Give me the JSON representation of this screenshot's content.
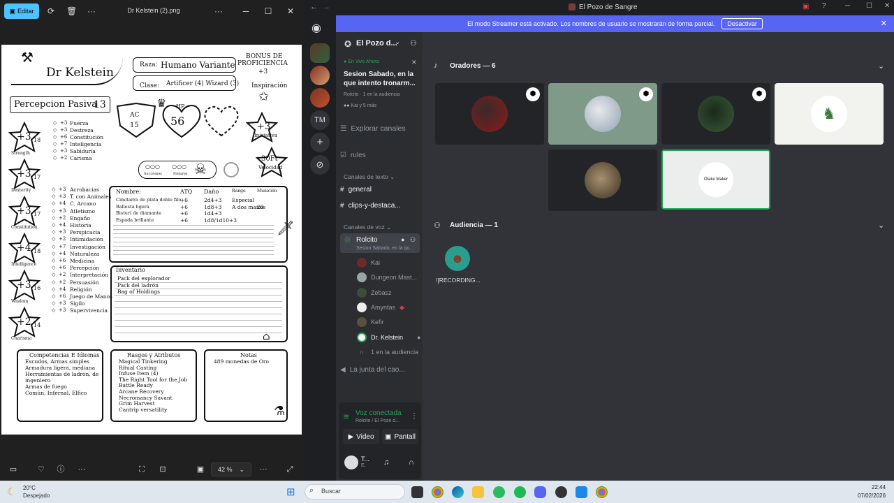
{
  "viewer": {
    "edit_label": "Editar",
    "title": "Dr Kelstein (2).png",
    "zoom": "42 %",
    "sheet": {
      "name": "Dr Kelstein",
      "race_label": "Raza:",
      "race_value": "Humano Variante",
      "class_label": "Clase:",
      "class_value": "Artificer (4) Wizard (3)",
      "prof_title_1": "BONUS DE",
      "prof_title_2": "PROFICIENCIA",
      "prof_value": "+3",
      "inspiration": "Inspiración",
      "passive_label": "Percepcion Pasiva",
      "passive_value": "13",
      "ac_label": "AC",
      "ac_value": "15",
      "hp_label": "HP",
      "hp_value": "56",
      "initiative_value": "+3",
      "initiative_label": "Iniciativa",
      "speed_value": "30Ft",
      "speed_label": "Velocidad",
      "successes": "Successes",
      "failures": "Failures",
      "abilities": [
        {
          "mod": "+3",
          "score": "18",
          "label": "Strength"
        },
        {
          "mod": "+3",
          "score": "17",
          "label": "Dexterity"
        },
        {
          "mod": "+3",
          "score": "17",
          "label": "Constitution"
        },
        {
          "mod": "+4",
          "score": "18",
          "label": "Intelligence"
        },
        {
          "mod": "+3",
          "score": "16",
          "label": "Wisdom"
        },
        {
          "mod": "+2",
          "score": "14",
          "label": "Charisma"
        }
      ],
      "saves": [
        {
          "v": "+3",
          "n": "Fuerza"
        },
        {
          "v": "+3",
          "n": "Destreza"
        },
        {
          "v": "+6",
          "n": "Constitución"
        },
        {
          "v": "+7",
          "n": "Inteligencia"
        },
        {
          "v": "+3",
          "n": "Sabiduria"
        },
        {
          "v": "+2",
          "n": "Carisma"
        }
      ],
      "skills": [
        {
          "v": "+3",
          "n": "Acrobacias"
        },
        {
          "v": "+3",
          "n": "T. con Animales"
        },
        {
          "v": "+4",
          "n": "C. Arcano"
        },
        {
          "v": "+3",
          "n": "Atletismo"
        },
        {
          "v": "+2",
          "n": "Engaño"
        },
        {
          "v": "+4",
          "n": "Historia"
        },
        {
          "v": "+3",
          "n": "Perspicacia"
        },
        {
          "v": "+2",
          "n": "Intimidación"
        },
        {
          "v": "+7",
          "n": "Investigación"
        },
        {
          "v": "+4",
          "n": "Naturaleza"
        },
        {
          "v": "+6",
          "n": "Medicina"
        },
        {
          "v": "+6",
          "n": "Percepción"
        },
        {
          "v": "+2",
          "n": "Interpretación"
        },
        {
          "v": "+2",
          "n": "Persuasión"
        },
        {
          "v": "+4",
          "n": "Religión"
        },
        {
          "v": "+6",
          "n": "Juego de Manos"
        },
        {
          "v": "+3",
          "n": "Sigilo"
        },
        {
          "v": "+3",
          "n": "Supervivencia"
        }
      ],
      "weapon_headers": [
        "Nombre:",
        "ATQ",
        "Daño",
        "Rango",
        "Munición"
      ],
      "weapons": [
        [
          "Cimitarra de plata doble filo",
          "+6",
          "2d4+3",
          "Especial",
          ""
        ],
        [
          "Ballesta ligera",
          "+6",
          "1d8+3",
          "A dos manos",
          "20"
        ],
        [
          "Bisturí de diamante",
          "+6",
          "1d4+3",
          "",
          ""
        ],
        [
          "Espada brillante",
          "+6",
          "1d8/1d10+3",
          "",
          ""
        ]
      ],
      "inventory_title": "Inventario",
      "inventory": [
        "Pack del explorador",
        "Pack del ladrón",
        "Bag of Holdings"
      ],
      "prof_box_title": "Competencias E Idiomas",
      "prof_box": [
        "Escudos, Armas simples",
        "Armadura ligera, mediana",
        "Herramientas de ladrón, de",
        "ingeniero",
        "Armas de fuego",
        "Común, Infernal, Elfico"
      ],
      "traits_title": "Rasgos y Atributos",
      "traits": [
        "Magical Tinkering",
        "Ritual Casting",
        "Infuse Item (4)",
        "The Right Tool for the Job",
        "Battle Ready",
        "Arcane Recovery",
        "Necromancy Savant",
        "Grim Harvest",
        "Cantrip versatility"
      ],
      "notes_title": "Notas",
      "notes": [
        "489 monedas de Oro"
      ]
    }
  },
  "discord": {
    "window_title": "El Pozo de Sangre",
    "banner_text": "El modo Streamer está activado. Los nombres de usuario se mostrarán de forma parcial.",
    "banner_button": "Desactivar",
    "server_name": "El Pozo d...",
    "server_initials": "TM",
    "live_label": "En Vivo Ahora",
    "live_title": "Sesion Sabado, en la que intento tronarm...",
    "live_meta": "Rolcito · 1 en la audiencia",
    "live_users": "Kai y 5 más",
    "explore": "Explorar canales",
    "rules": "rules",
    "text_category": "Canales de texto",
    "text_channels": [
      "general",
      "clips-y-destaca..."
    ],
    "voice_category": "Canales de voz",
    "stage_channel": "Rolcito",
    "stage_topic": "Sesion Sabado, en la qu...",
    "voice_users": [
      "Kai",
      "Dungeon Mast...",
      "Zebasz",
      "Amyntas",
      "Kefir",
      "Dr. Kelstein"
    ],
    "audience_count": "1 en la audiencia",
    "other_channel": "La junta del cao...",
    "voice_connected": "Voz conectada",
    "voice_location": "Rolcito / El Pozo d...",
    "video_label": "Video",
    "screen_label": "Pantall",
    "self_name": "T...",
    "self_status": "E.",
    "speakers_label": "Oradores — 6",
    "audience_label": "Audiencia — 1",
    "tile_text": "Otaku Maker",
    "audience_user": "![RECORDING..."
  },
  "taskbar": {
    "weather_temp": "20°C",
    "weather_desc": "Despejado",
    "search_placeholder": "Buscar",
    "time": "22:44",
    "date": "07/02/2026"
  }
}
